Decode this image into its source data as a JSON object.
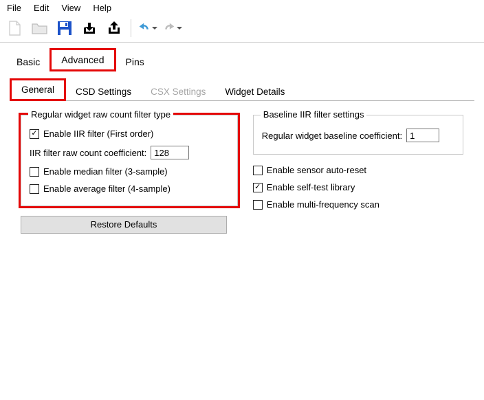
{
  "menu": {
    "file": "File",
    "edit": "Edit",
    "view": "View",
    "help": "Help"
  },
  "tabs": {
    "basic": "Basic",
    "advanced": "Advanced",
    "pins": "Pins"
  },
  "innerTabs": {
    "general": "General",
    "csd": "CSD Settings",
    "csx": "CSX Settings",
    "widgetDetails": "Widget Details"
  },
  "rawFilter": {
    "groupTitle": "Regular widget raw count filter type",
    "enableIIR": "Enable IIR filter (First order)",
    "iirCoeffLabel": "IIR filter raw count coefficient:",
    "iirCoeffValue": "128",
    "enableMedian": "Enable median filter (3-sample)",
    "enableAverage": "Enable average filter (4-sample)"
  },
  "baseline": {
    "groupTitle": "Baseline IIR filter settings",
    "coeffLabel": "Regular widget baseline coefficient:",
    "coeffValue": "1"
  },
  "rightChecks": {
    "autoReset": "Enable sensor auto-reset",
    "selfTest": "Enable self-test library",
    "multiFreq": "Enable multi-frequency scan"
  },
  "restore": "Restore Defaults"
}
